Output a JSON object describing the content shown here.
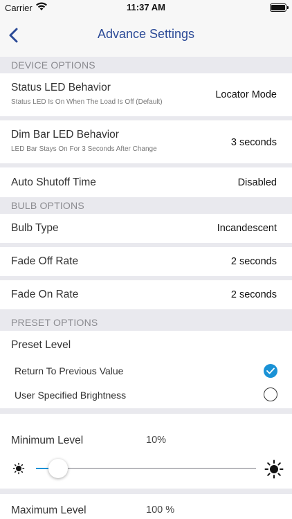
{
  "status_bar": {
    "carrier": "Carrier",
    "time": "11:37 AM",
    "wifi_icon": "wifi-icon",
    "battery_icon": "battery-icon",
    "battery_level": 1.0
  },
  "nav": {
    "back_icon": "chevron-left-icon",
    "title": "Advance Settings",
    "title_color": "#2b4a97"
  },
  "device_options": {
    "header": "DEVICE OPTIONS",
    "status_led": {
      "label": "Status LED Behavior",
      "sublabel": "Status LED Is On When The Load Is Off (Default)",
      "value": "Locator Mode"
    },
    "dim_bar_led": {
      "label": "Dim Bar LED Behavior",
      "sublabel": "LED Bar Stays On For 3 Seconds After Change",
      "value": "3 seconds"
    },
    "auto_shutoff": {
      "label": "Auto Shutoff Time",
      "value": "Disabled"
    }
  },
  "bulb_options": {
    "header": "BULB OPTIONS",
    "bulb_type": {
      "label": "Bulb Type",
      "value": "Incandescent"
    },
    "fade_off": {
      "label": "Fade Off Rate",
      "value": "2 seconds"
    },
    "fade_on": {
      "label": "Fade On Rate",
      "value": "2 seconds"
    }
  },
  "preset_options": {
    "header": "PRESET OPTIONS",
    "preset_level_label": "Preset Level",
    "options": [
      {
        "label": "Return To Previous Value",
        "selected": true
      },
      {
        "label": "User Specified Brightness",
        "selected": false
      }
    ],
    "accent_color": "#1a92d6"
  },
  "levels": {
    "minimum": {
      "label": "Minimum Level",
      "value": "10%",
      "fraction": 0.1
    },
    "maximum": {
      "label": "Maximum Level",
      "value": "100 %"
    },
    "low_icon": "sun-small-icon",
    "high_icon": "sun-large-icon"
  }
}
